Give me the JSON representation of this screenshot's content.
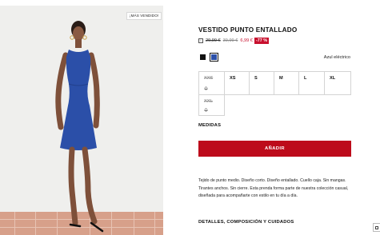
{
  "image": {
    "alt": "",
    "badge": "¡MÁS VENDIDO!"
  },
  "product": {
    "title": "VESTIDO PUNTO ENTALLADO",
    "info_icon": "info-icon",
    "price_original": "29,99 €",
    "price_previous": "39,99 €",
    "price_current": "6,99 €",
    "discount": "-77 %",
    "color_selected": "Azul eléctrico",
    "colors": [
      "#111111",
      "#2b4fa8"
    ]
  },
  "sizes": [
    {
      "label": "XXS",
      "available": false
    },
    {
      "label": "XS",
      "available": true
    },
    {
      "label": "S",
      "available": true
    },
    {
      "label": "M",
      "available": true
    },
    {
      "label": "L",
      "available": true
    },
    {
      "label": "XL",
      "available": true
    },
    {
      "label": "XXL",
      "available": false
    }
  ],
  "measures_label": "MEDIDAS",
  "add_button": "AÑADIR",
  "description": "Tejido de punto medio. Diseño corto. Diseño entallado. Cuello caja. Sin mangas. Tirantes anchos. Sin cierre. Esta prenda forma parte de nuestra colección casual, diseñada para acompañarte con estilo en tu día a día.",
  "details_label": "DETALLES, COMPOSICIÓN Y CUIDADOS",
  "colors": {
    "accent_red": "#bd0b1b",
    "discount_red": "#c8102e",
    "dress_blue": "#2b4fa8"
  }
}
